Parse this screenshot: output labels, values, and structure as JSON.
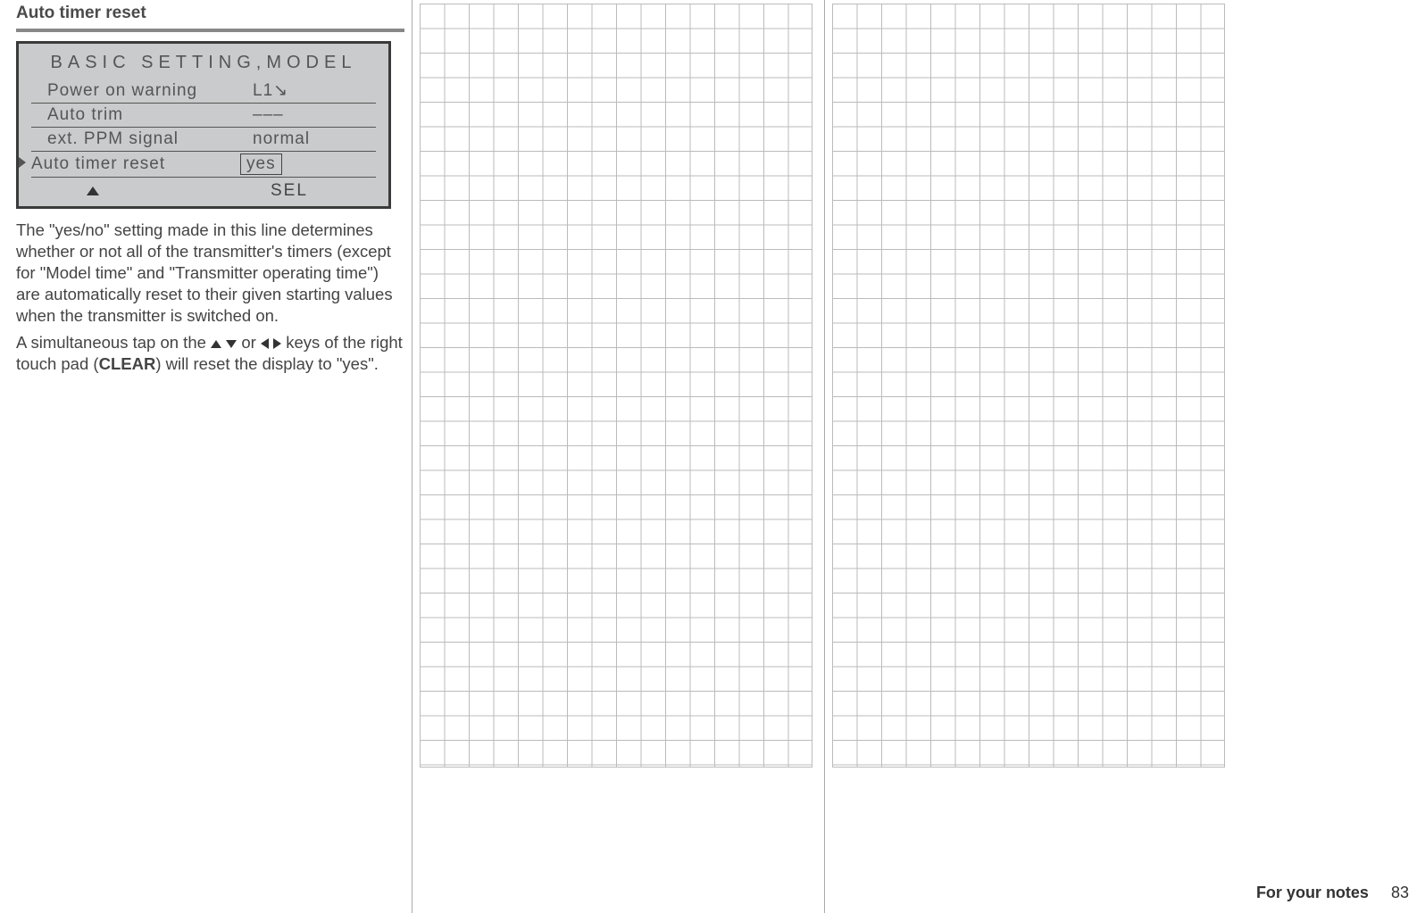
{
  "section": {
    "title": "Auto timer reset"
  },
  "lcd": {
    "header": "BASIC SETTING,MODEL",
    "rows": [
      {
        "label": "Power on warning",
        "value": "L1↘",
        "indicator": ""
      },
      {
        "label": "Auto trim",
        "value": "–––",
        "indicator": ""
      },
      {
        "label": "ext. PPM signal",
        "value": "normal",
        "indicator": ""
      },
      {
        "label": "Auto timer reset",
        "value": "yes",
        "indicator": "▶",
        "boxed": true
      }
    ],
    "footer_sel": "SEL"
  },
  "paragraphs": {
    "p1": "The \"yes/no\" setting made in this line determines whether or not all of the transmitter's timers (except for \"Model time\" and \"Transmitter operating time\") are automatically reset to their given starting values when the transmitter is switched on.",
    "p2_a": "A simultaneous tap on the ",
    "p2_b": " or ",
    "p2_c": " keys of the right touch pad (",
    "p2_clear": "CLEAR",
    "p2_d": ") will reset the display to \"yes\"."
  },
  "footer": {
    "label": "For your notes",
    "page": "83"
  }
}
